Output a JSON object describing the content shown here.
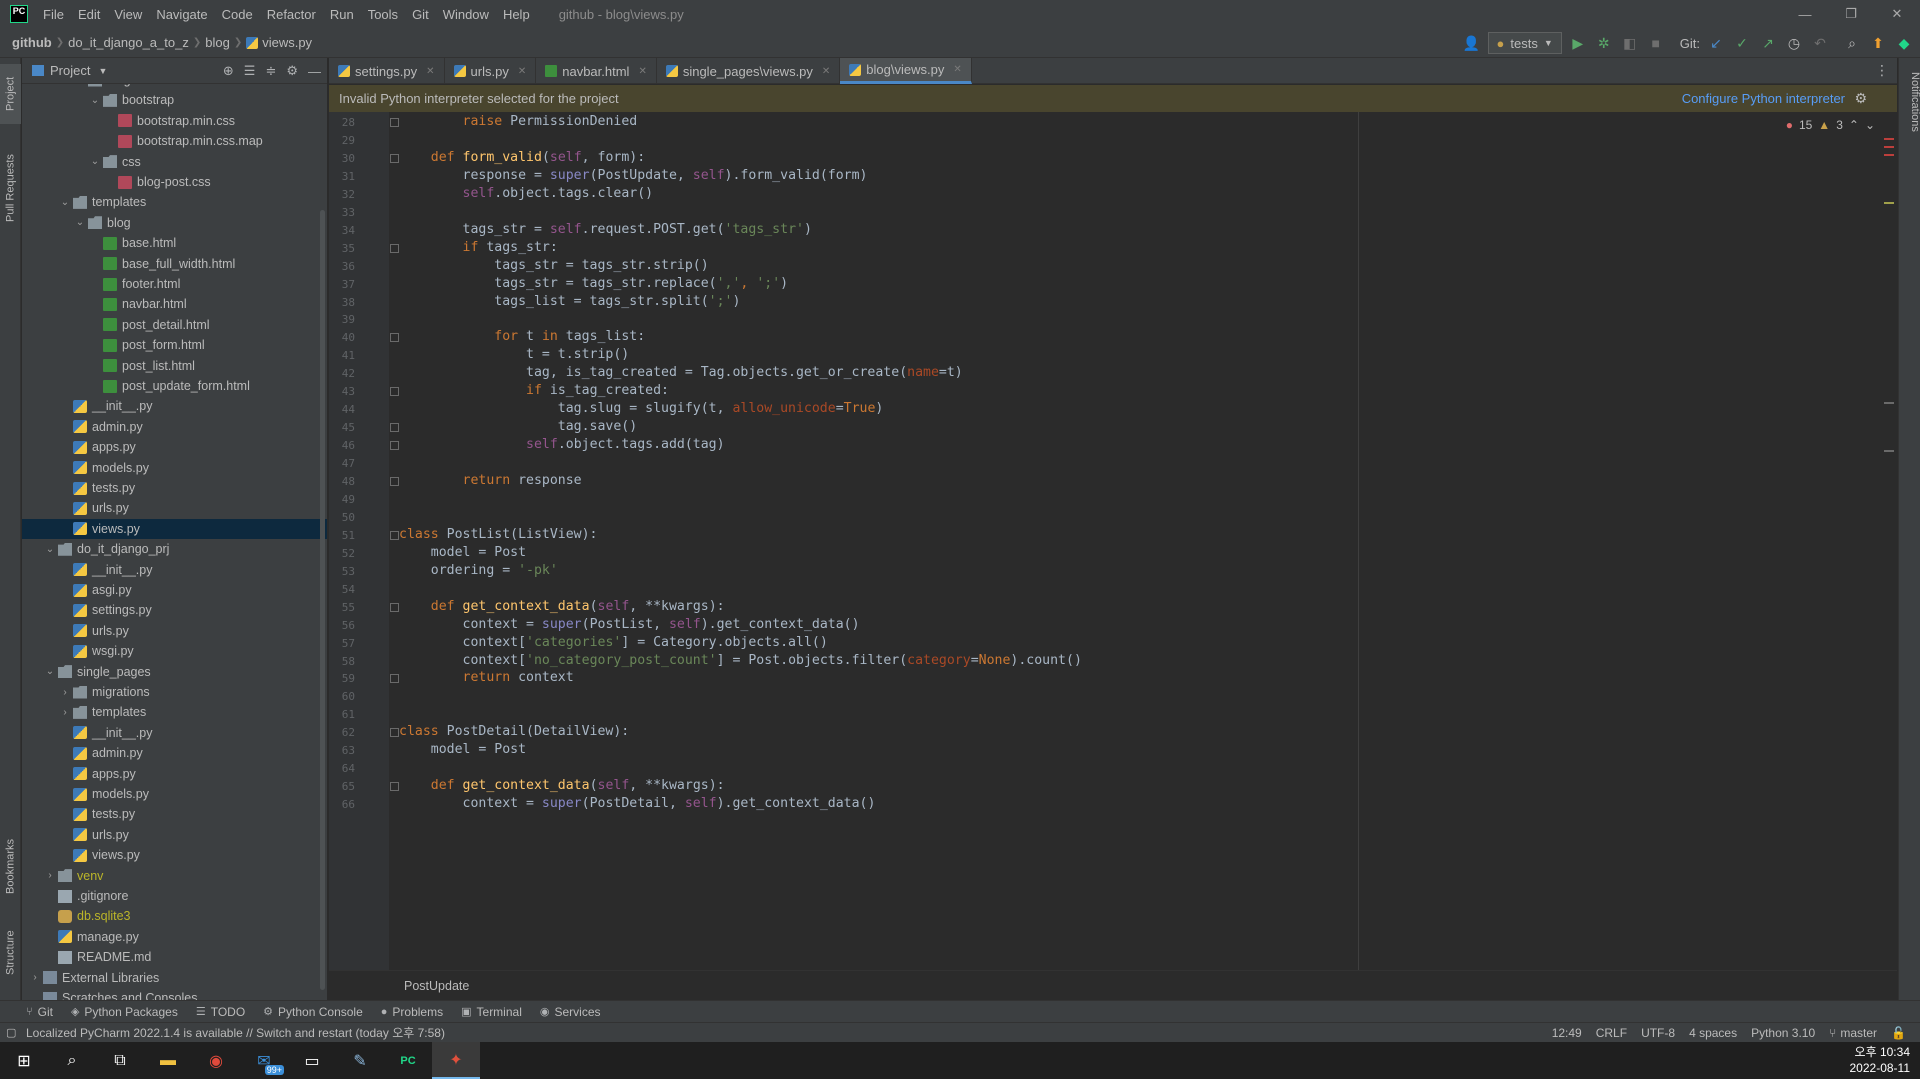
{
  "menu": {
    "logo": "PC",
    "items": [
      "File",
      "Edit",
      "View",
      "Navigate",
      "Code",
      "Refactor",
      "Run",
      "Tools",
      "Git",
      "Window",
      "Help"
    ],
    "window_title": "github - blog\\views.py"
  },
  "window_controls": {
    "minimize": "—",
    "restore": "❐",
    "close": "✕"
  },
  "breadcrumbs": [
    "github",
    "do_it_django_a_to_z",
    "blog",
    "views.py"
  ],
  "nav_toolbar": {
    "run_config": "tests",
    "git_label": "Git:"
  },
  "left_strip": {
    "project": "Project",
    "pull_requests": "Pull Requests",
    "bookmarks": "Bookmarks",
    "structure": "Structure"
  },
  "project_panel": {
    "title": "Project",
    "tree": [
      {
        "label": "blog",
        "depth": 4,
        "type": "folder",
        "arrow": "open"
      },
      {
        "label": "bootstrap",
        "depth": 5,
        "type": "folder",
        "arrow": "open"
      },
      {
        "label": "bootstrap.min.css",
        "depth": 6,
        "type": "css"
      },
      {
        "label": "bootstrap.min.css.map",
        "depth": 6,
        "type": "css"
      },
      {
        "label": "css",
        "depth": 5,
        "type": "folder",
        "arrow": "open"
      },
      {
        "label": "blog-post.css",
        "depth": 6,
        "type": "css"
      },
      {
        "label": "templates",
        "depth": 3,
        "type": "folder",
        "arrow": "open"
      },
      {
        "label": "blog",
        "depth": 4,
        "type": "folder",
        "arrow": "open"
      },
      {
        "label": "base.html",
        "depth": 5,
        "type": "html"
      },
      {
        "label": "base_full_width.html",
        "depth": 5,
        "type": "html"
      },
      {
        "label": "footer.html",
        "depth": 5,
        "type": "html"
      },
      {
        "label": "navbar.html",
        "depth": 5,
        "type": "html"
      },
      {
        "label": "post_detail.html",
        "depth": 5,
        "type": "html"
      },
      {
        "label": "post_form.html",
        "depth": 5,
        "type": "html"
      },
      {
        "label": "post_list.html",
        "depth": 5,
        "type": "html"
      },
      {
        "label": "post_update_form.html",
        "depth": 5,
        "type": "html"
      },
      {
        "label": "__init__.py",
        "depth": 3,
        "type": "py"
      },
      {
        "label": "admin.py",
        "depth": 3,
        "type": "py"
      },
      {
        "label": "apps.py",
        "depth": 3,
        "type": "py"
      },
      {
        "label": "models.py",
        "depth": 3,
        "type": "py"
      },
      {
        "label": "tests.py",
        "depth": 3,
        "type": "py"
      },
      {
        "label": "urls.py",
        "depth": 3,
        "type": "py"
      },
      {
        "label": "views.py",
        "depth": 3,
        "type": "py",
        "selected": true
      },
      {
        "label": "do_it_django_prj",
        "depth": 2,
        "type": "folder",
        "arrow": "open"
      },
      {
        "label": "__init__.py",
        "depth": 3,
        "type": "py"
      },
      {
        "label": "asgi.py",
        "depth": 3,
        "type": "py"
      },
      {
        "label": "settings.py",
        "depth": 3,
        "type": "py"
      },
      {
        "label": "urls.py",
        "depth": 3,
        "type": "py"
      },
      {
        "label": "wsgi.py",
        "depth": 3,
        "type": "py"
      },
      {
        "label": "single_pages",
        "depth": 2,
        "type": "folder",
        "arrow": "open"
      },
      {
        "label": "migrations",
        "depth": 3,
        "type": "folder",
        "arrow": "closed"
      },
      {
        "label": "templates",
        "depth": 3,
        "type": "folder",
        "arrow": "closed"
      },
      {
        "label": "__init__.py",
        "depth": 3,
        "type": "py"
      },
      {
        "label": "admin.py",
        "depth": 3,
        "type": "py"
      },
      {
        "label": "apps.py",
        "depth": 3,
        "type": "py"
      },
      {
        "label": "models.py",
        "depth": 3,
        "type": "py"
      },
      {
        "label": "tests.py",
        "depth": 3,
        "type": "py"
      },
      {
        "label": "urls.py",
        "depth": 3,
        "type": "py"
      },
      {
        "label": "views.py",
        "depth": 3,
        "type": "py"
      },
      {
        "label": "venv",
        "depth": 2,
        "type": "folder",
        "arrow": "closed",
        "olive": true
      },
      {
        "label": ".gitignore",
        "depth": 2,
        "type": "file"
      },
      {
        "label": "db.sqlite3",
        "depth": 2,
        "type": "db",
        "olive": true
      },
      {
        "label": "manage.py",
        "depth": 2,
        "type": "py"
      },
      {
        "label": "README.md",
        "depth": 2,
        "type": "file"
      },
      {
        "label": "External Libraries",
        "depth": 1,
        "type": "lib",
        "arrow": "closed"
      },
      {
        "label": "Scratches and Consoles",
        "depth": 1,
        "type": "lib"
      }
    ]
  },
  "editor_tabs": [
    {
      "label": "settings.py",
      "type": "py"
    },
    {
      "label": "urls.py",
      "type": "py"
    },
    {
      "label": "navbar.html",
      "type": "html"
    },
    {
      "label": "single_pages\\views.py",
      "type": "py"
    },
    {
      "label": "blog\\views.py",
      "type": "py",
      "active": true
    }
  ],
  "banner": {
    "message": "Invalid Python interpreter selected for the project",
    "link": "Configure Python interpreter"
  },
  "inspections": {
    "errors": "15",
    "warnings": "3"
  },
  "code": {
    "first_line": 28,
    "lines": [
      [
        [
          "        ",
          ""
        ],
        [
          "raise ",
          "kw"
        ],
        [
          "PermissionDenied",
          ""
        ]
      ],
      [],
      [
        [
          "    ",
          ""
        ],
        [
          "def ",
          "kw"
        ],
        [
          "form_valid",
          "fn"
        ],
        [
          "(",
          ""
        ],
        [
          "self",
          "self"
        ],
        [
          ", form):",
          ""
        ]
      ],
      [
        [
          "        response = ",
          ""
        ],
        [
          "super",
          "builtin"
        ],
        [
          "(PostUpdate, ",
          ""
        ],
        [
          "self",
          "self"
        ],
        [
          ").form_valid(form)",
          ""
        ]
      ],
      [
        [
          "        ",
          ""
        ],
        [
          "self",
          "self"
        ],
        [
          ".object.tags.clear()",
          ""
        ]
      ],
      [],
      [
        [
          "        tags_str = ",
          ""
        ],
        [
          "self",
          "self"
        ],
        [
          ".request.POST.get(",
          ""
        ],
        [
          "'tags_str'",
          "str"
        ],
        [
          ")",
          ""
        ]
      ],
      [
        [
          "        ",
          ""
        ],
        [
          "if ",
          "kw"
        ],
        [
          "tags_str:",
          ""
        ]
      ],
      [
        [
          "            tags_str = tags_str.strip()",
          ""
        ]
      ],
      [
        [
          "            tags_str = tags_str.replace(",
          ""
        ],
        [
          "','",
          "str"
        ],
        [
          ", ",
          "kw"
        ],
        [
          "';'",
          "str"
        ],
        [
          ")",
          ""
        ]
      ],
      [
        [
          "            tags_list = tags_str.split(",
          ""
        ],
        [
          "';'",
          "str"
        ],
        [
          ")",
          ""
        ]
      ],
      [],
      [
        [
          "            ",
          ""
        ],
        [
          "for ",
          "kw"
        ],
        [
          "t ",
          ""
        ],
        [
          "in ",
          "kw"
        ],
        [
          "tags_list:",
          ""
        ]
      ],
      [
        [
          "                t = t.strip()",
          ""
        ]
      ],
      [
        [
          "                tag, is_tag_created = Tag.objects.get_or_create(",
          ""
        ],
        [
          "name",
          "param"
        ],
        [
          "=t)",
          ""
        ]
      ],
      [
        [
          "                ",
          ""
        ],
        [
          "if ",
          "kw"
        ],
        [
          "is_tag_created:",
          ""
        ]
      ],
      [
        [
          "                    tag.slug = slugify(t, ",
          ""
        ],
        [
          "allow_unicode",
          "param"
        ],
        [
          "=",
          ""
        ],
        [
          "True",
          "kw"
        ],
        [
          ")",
          ""
        ]
      ],
      [
        [
          "                    tag.save()",
          ""
        ]
      ],
      [
        [
          "                ",
          ""
        ],
        [
          "self",
          "self"
        ],
        [
          ".object.tags.add(tag)",
          ""
        ]
      ],
      [],
      [
        [
          "        ",
          ""
        ],
        [
          "return ",
          "kw"
        ],
        [
          "response",
          ""
        ]
      ],
      [],
      [],
      [
        [
          "class ",
          "kw"
        ],
        [
          "PostList(ListView):",
          ""
        ]
      ],
      [
        [
          "    model = Post",
          ""
        ]
      ],
      [
        [
          "    ordering = ",
          ""
        ],
        [
          "'-pk'",
          "str"
        ]
      ],
      [],
      [
        [
          "    ",
          ""
        ],
        [
          "def ",
          "kw"
        ],
        [
          "get_context_data",
          "fn"
        ],
        [
          "(",
          ""
        ],
        [
          "self",
          "self"
        ],
        [
          ", **kwargs):",
          ""
        ]
      ],
      [
        [
          "        context = ",
          ""
        ],
        [
          "super",
          "builtin"
        ],
        [
          "(PostList, ",
          ""
        ],
        [
          "self",
          "self"
        ],
        [
          ").get_context_data()",
          ""
        ]
      ],
      [
        [
          "        context[",
          ""
        ],
        [
          "'categories'",
          "str"
        ],
        [
          "] = Category.objects.all()",
          ""
        ]
      ],
      [
        [
          "        context[",
          ""
        ],
        [
          "'no_category_post_count'",
          "str"
        ],
        [
          "] = Post.objects.filter(",
          ""
        ],
        [
          "category",
          "param"
        ],
        [
          "=",
          ""
        ],
        [
          "None",
          "kw"
        ],
        [
          ").count()",
          ""
        ]
      ],
      [
        [
          "        ",
          ""
        ],
        [
          "return ",
          "kw"
        ],
        [
          "context",
          ""
        ]
      ],
      [],
      [],
      [
        [
          "class ",
          "kw"
        ],
        [
          "PostDetail(DetailView):",
          ""
        ]
      ],
      [
        [
          "    model = Post",
          ""
        ]
      ],
      [],
      [
        [
          "    ",
          ""
        ],
        [
          "def ",
          "kw"
        ],
        [
          "get_context_data",
          "fn"
        ],
        [
          "(",
          ""
        ],
        [
          "self",
          "self"
        ],
        [
          ", **kwargs):",
          ""
        ]
      ],
      [
        [
          "        context = ",
          ""
        ],
        [
          "super",
          "builtin"
        ],
        [
          "(PostDetail, ",
          ""
        ],
        [
          "self",
          "self"
        ],
        [
          ").get_context_data()",
          ""
        ]
      ]
    ],
    "fold_lines": [
      28,
      30,
      35,
      40,
      43,
      45,
      46,
      48,
      51,
      55,
      59,
      62,
      65
    ]
  },
  "editor_breadcrumb": "PostUpdate",
  "right_strip": {
    "notifications": "Notifications"
  },
  "tool_windows": [
    {
      "icon": "⑂",
      "label": "Git"
    },
    {
      "icon": "◈",
      "label": "Python Packages"
    },
    {
      "icon": "☰",
      "label": "TODO"
    },
    {
      "icon": "⚙",
      "label": "Python Console"
    },
    {
      "icon": "●",
      "label": "Problems"
    },
    {
      "icon": "▣",
      "label": "Terminal"
    },
    {
      "icon": "◉",
      "label": "Services"
    }
  ],
  "status": {
    "message": "Localized PyCharm 2022.1.4 is available // Switch and restart (today 오후 7:58)",
    "position": "12:49",
    "line_sep": "CRLF",
    "encoding": "UTF-8",
    "indent": "4 spaces",
    "interpreter": "Python 3.10",
    "branch": "master"
  },
  "taskbar": {
    "badge": "99+",
    "time": "오후 10:34",
    "date": "2022-08-11"
  }
}
